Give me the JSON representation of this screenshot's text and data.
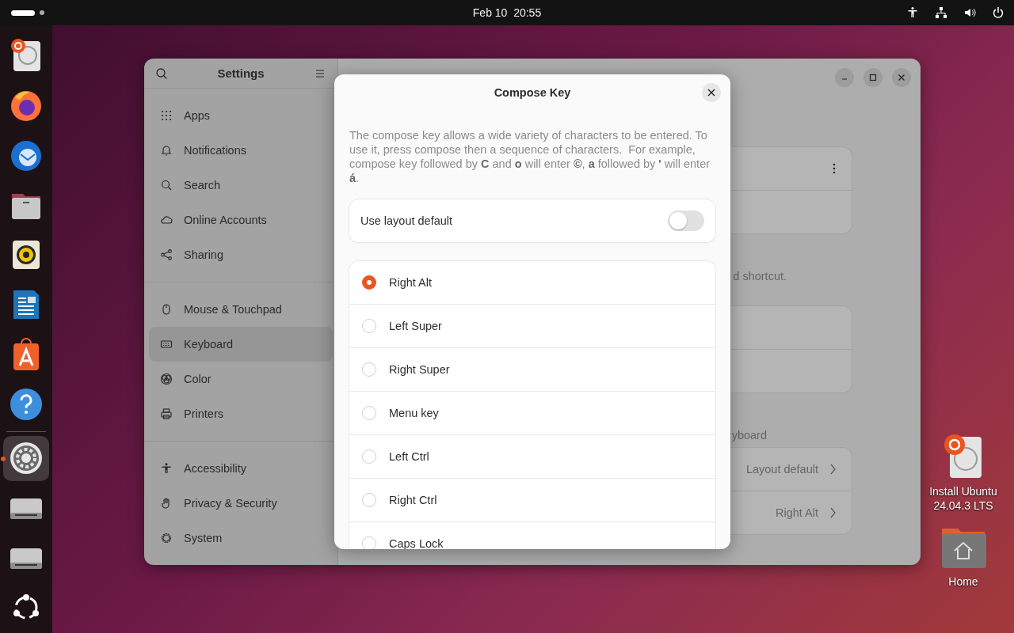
{
  "top_bar": {
    "clock": "Feb 10  20:55"
  },
  "dock": [
    {
      "kind": "installer",
      "running": false
    },
    {
      "kind": "browser",
      "running": false
    },
    {
      "kind": "mail",
      "running": false
    },
    {
      "kind": "files",
      "running": false
    },
    {
      "kind": "music",
      "running": false
    },
    {
      "kind": "writer",
      "running": false
    },
    {
      "kind": "store",
      "running": false
    },
    {
      "kind": "help",
      "running": false
    },
    {
      "kind": "settings",
      "running": true
    },
    {
      "kind": "drive",
      "running": false
    },
    {
      "kind": "drive",
      "running": false
    },
    {
      "kind": "apps",
      "running": false
    }
  ],
  "settings_window": {
    "sidebar": {
      "title": "Settings",
      "groups": [
        [
          {
            "label": "Apps",
            "selected": false
          },
          {
            "label": "Notifications",
            "selected": false
          },
          {
            "label": "Search",
            "selected": false
          },
          {
            "label": "Online Accounts",
            "selected": false
          },
          {
            "label": "Sharing",
            "selected": false
          }
        ],
        [
          {
            "label": "Mouse & Touchpad",
            "selected": false
          },
          {
            "label": "Keyboard",
            "selected": true
          },
          {
            "label": "Color",
            "selected": false
          },
          {
            "label": "Printers",
            "selected": false
          }
        ],
        [
          {
            "label": "Accessibility",
            "selected": false
          },
          {
            "label": "Privacy & Security",
            "selected": false
          },
          {
            "label": "System",
            "selected": false
          }
        ]
      ]
    },
    "content": {
      "shortcut_note": "d shortcut.",
      "section_label": "yboard",
      "rows": [
        {
          "value": "Layout default"
        },
        {
          "value": "Right Alt"
        }
      ]
    }
  },
  "dialog": {
    "title": "Compose Key",
    "description": "The compose key allows a wide variety of characters to be entered. To use it, press compose then a sequence of characters.  For example, compose key followed by **C** and **o** will enter **©**, **a** followed by **'** will enter **á**.",
    "toggle": {
      "label": "Use layout default",
      "on": false
    },
    "options": [
      {
        "label": "Right Alt",
        "selected": true
      },
      {
        "label": "Left Super",
        "selected": false
      },
      {
        "label": "Right Super",
        "selected": false
      },
      {
        "label": "Menu key",
        "selected": false
      },
      {
        "label": "Left Ctrl",
        "selected": false
      },
      {
        "label": "Right Ctrl",
        "selected": false
      },
      {
        "label": "Caps Lock",
        "selected": false
      }
    ]
  },
  "desktop_icons": [
    {
      "kind": "installer",
      "label": "Install Ubuntu 24.04.3 LTS"
    },
    {
      "kind": "home",
      "label": "Home"
    }
  ]
}
